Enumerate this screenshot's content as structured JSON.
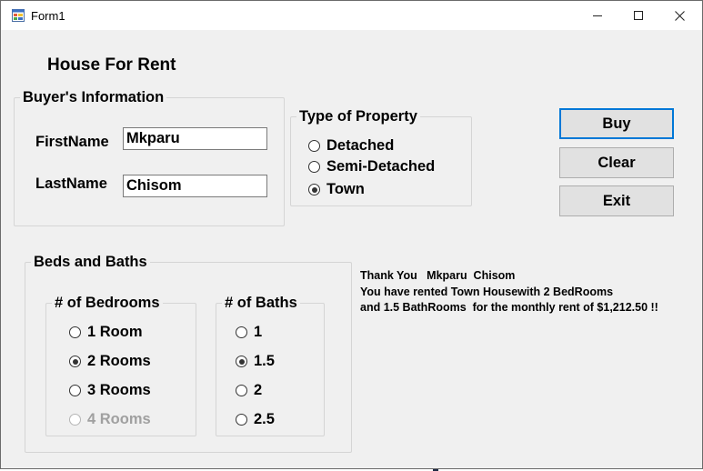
{
  "window": {
    "title": "Form1",
    "icon": "app-form-icon",
    "controls": {
      "minimize": "minimize-icon",
      "maximize": "maximize-icon",
      "close": "close-icon"
    }
  },
  "form": {
    "heading": "House For Rent",
    "buyer_info": {
      "legend": "Buyer's Information",
      "first_name_label": "FirstName",
      "first_name_value": "Mkparu",
      "last_name_label": "LastName",
      "last_name_value": "Chisom"
    },
    "property_type": {
      "legend": "Type of Property",
      "options": [
        {
          "label": "Detached",
          "checked": false
        },
        {
          "label": "Semi-Detached",
          "checked": false
        },
        {
          "label": "Town",
          "checked": true
        }
      ]
    },
    "buttons": {
      "buy": "Buy",
      "clear": "Clear",
      "exit": "Exit"
    },
    "beds_baths": {
      "legend": "Beds and Baths",
      "bedrooms": {
        "legend": "# of Bedrooms",
        "options": [
          {
            "label": "1 Room",
            "checked": false,
            "enabled": true
          },
          {
            "label": "2 Rooms",
            "checked": true,
            "enabled": true
          },
          {
            "label": "3 Rooms",
            "checked": false,
            "enabled": true
          },
          {
            "label": "4 Rooms",
            "checked": false,
            "enabled": false
          }
        ]
      },
      "baths": {
        "legend": "# of Baths",
        "options": [
          {
            "label": "1",
            "checked": false
          },
          {
            "label": "1.5",
            "checked": true
          },
          {
            "label": "2",
            "checked": false
          },
          {
            "label": "2.5",
            "checked": false
          }
        ]
      }
    },
    "message": {
      "line1": "Thank You   Mkparu  Chisom",
      "line2": "You have rented Town Housewith 2 BedRooms",
      "line3": "and 1.5 BathRooms  for the monthly rent of $1,212.50 !!"
    }
  },
  "colors": {
    "window_bg": "#f0f0f0",
    "titlebar_bg": "#ffffff",
    "button_bg": "#e1e1e1",
    "default_button_border": "#0078d7",
    "disabled_text": "#a0a0a0"
  }
}
